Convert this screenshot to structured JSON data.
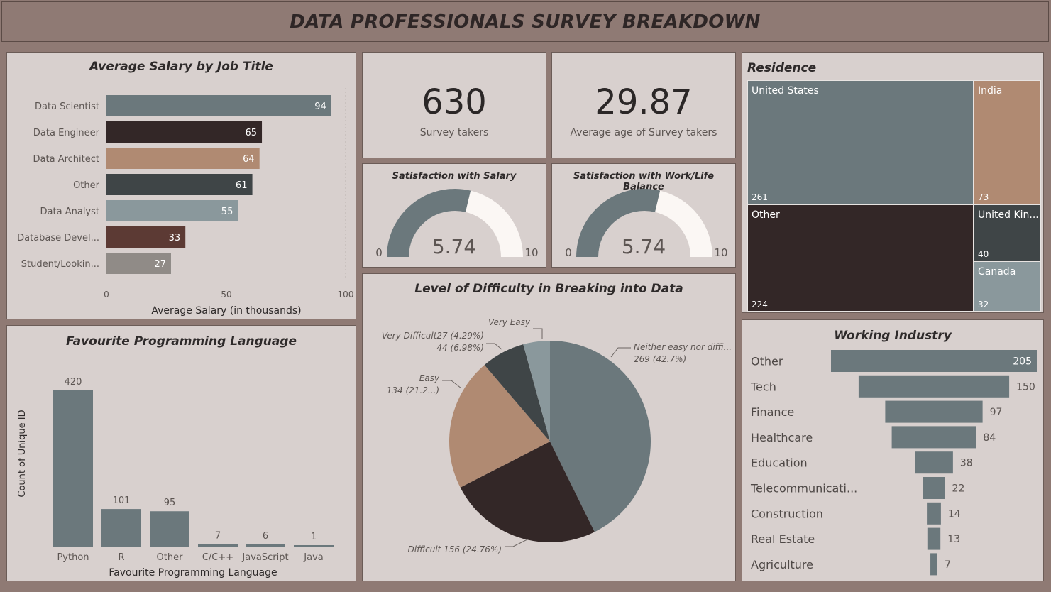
{
  "header": {
    "title": "DATA PROFESSIONALS SURVEY BREAKDOWN"
  },
  "colors": {
    "background": "#8f7a74",
    "panel": "#d8d0ce",
    "slate": "#6b787c",
    "dark": "#332727",
    "tan": "#b08a72",
    "charcoal": "#3f4547",
    "light_slate": "#8a989c",
    "brown": "#5c3a34",
    "grey": "#908b87",
    "cream": "#fbf7f4"
  },
  "salary_chart": {
    "title": "Average Salary by Job Title",
    "xlabel": "Average Salary (in thousands)",
    "ticks": [
      "0",
      "50",
      "100"
    ]
  },
  "kpis": {
    "survey_takers": {
      "value": "630",
      "label": "Survey takers"
    },
    "avg_age": {
      "value": "29.87",
      "label": "Average age of Survey takers"
    }
  },
  "gauges": {
    "salary": {
      "title": "Satisfaction with Salary",
      "value": "5.74",
      "min": "0",
      "max": "10",
      "fraction": 0.574
    },
    "balance": {
      "title": "Satisfaction with Work/Life Balance",
      "value": "5.74",
      "min": "0",
      "max": "10",
      "fraction": 0.574
    }
  },
  "residence": {
    "title": "Residence",
    "items": [
      {
        "name": "United States",
        "value": "261"
      },
      {
        "name": "India",
        "value": "73"
      },
      {
        "name": "Other",
        "value": "224"
      },
      {
        "name": "United Kin...",
        "value": "40"
      },
      {
        "name": "Canada",
        "value": "32"
      }
    ]
  },
  "language_chart": {
    "title": "Favourite Programming Language",
    "xlabel": "Favourite Programming Language",
    "ylabel": "Count of Unique ID"
  },
  "difficulty_chart": {
    "title": "Level of Difficulty in Breaking into Data"
  },
  "industry_chart": {
    "title": "Working Industry"
  },
  "chart_data": [
    {
      "type": "bar",
      "orientation": "horizontal",
      "title": "Average Salary by Job Title",
      "xlabel": "Average Salary (in thousands)",
      "categories": [
        "Data Scientist",
        "Data Engineer",
        "Data Architect",
        "Other",
        "Data Analyst",
        "Database Devel...",
        "Student/Lookin..."
      ],
      "values": [
        94,
        65,
        64,
        61,
        55,
        33,
        27
      ],
      "xlim": [
        0,
        100
      ],
      "colors": [
        "#6b787c",
        "#332727",
        "#b08a72",
        "#3f4547",
        "#8a989c",
        "#5c3a34",
        "#908b87"
      ]
    },
    {
      "type": "bar",
      "title": "Favourite Programming Language",
      "xlabel": "Favourite Programming Language",
      "ylabel": "Count of Unique ID",
      "categories": [
        "Python",
        "R",
        "Other",
        "C/C++",
        "JavaScript",
        "Java"
      ],
      "values": [
        420,
        101,
        95,
        7,
        6,
        1
      ]
    },
    {
      "type": "pie",
      "title": "Level of Difficulty in Breaking into Data",
      "slices": [
        {
          "name": "Neither easy nor diffi...",
          "value": 269,
          "percent": "42.7%",
          "label": "Neither easy nor diffi...\n269 (42.7%)",
          "color": "#6b787c"
        },
        {
          "name": "Difficult",
          "value": 156,
          "percent": "24.76%",
          "label": "Difficult 156 (24.76%)",
          "color": "#332727"
        },
        {
          "name": "Easy",
          "value": 134,
          "percent": "21.2...",
          "label": "Easy\n134 (21.2...)",
          "color": "#b08a72"
        },
        {
          "name": "Very Difficult",
          "value": 44,
          "percent": "6.98%",
          "label": "Very Difficult27 (4.29%)\n44 (6.98%)",
          "color": "#3f4547"
        },
        {
          "name": "Very Easy",
          "value": 27,
          "percent": "4.29%",
          "label": "Very Easy",
          "color": "#8a989c"
        }
      ]
    },
    {
      "type": "bar",
      "subtype": "funnel",
      "title": "Working Industry",
      "categories": [
        "Other",
        "Tech",
        "Finance",
        "Healthcare",
        "Education",
        "Telecommunicati...",
        "Construction",
        "Real Estate",
        "Agriculture"
      ],
      "values": [
        205,
        150,
        97,
        84,
        38,
        22,
        14,
        13,
        7
      ]
    }
  ]
}
